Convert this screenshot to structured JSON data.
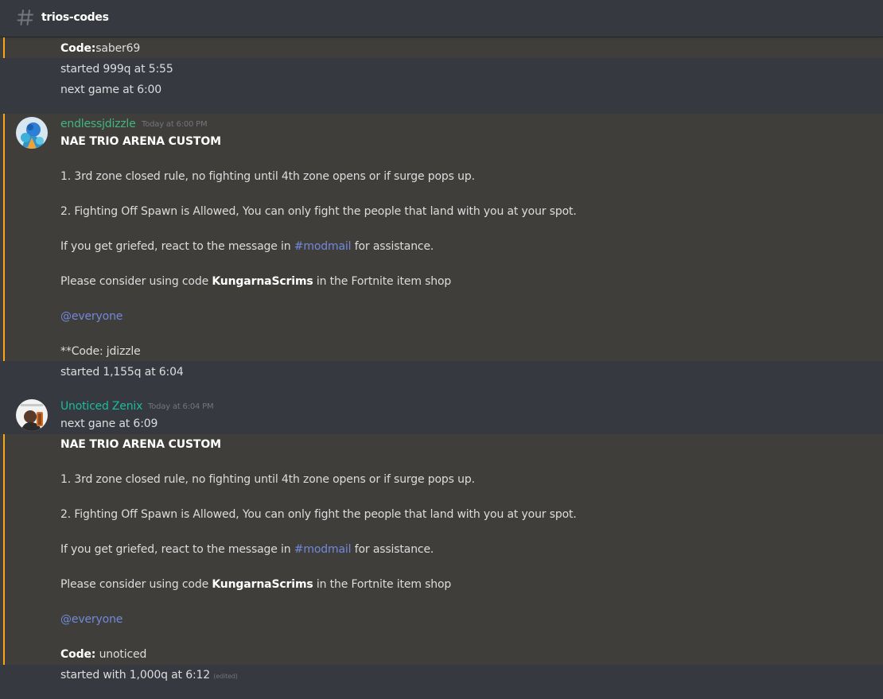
{
  "channel": {
    "name": "trios-codes",
    "icon": "hash-icon"
  },
  "colors": {
    "background": "#36393f",
    "highlight_bg": "#3f3e3b",
    "highlight_bar": "#faa61a",
    "mention": "#7289da",
    "author_jdizzle": "#43b581",
    "author_zenix": "#1abc9c"
  },
  "messages": {
    "m0": {
      "code_label": "Code:",
      "code_value": "saber69",
      "started": "started 999q at 5:55",
      "next": "next game at 6:00"
    },
    "m1": {
      "author": "endlessjdizzle",
      "timestamp": "Today at 6:00 PM",
      "title": "NAE TRIO ARENA CUSTOM",
      "rule1": "1. 3rd zone closed rule, no fighting until 4th zone opens or if surge pops up.",
      "rule2": "2. Fighting Off Spawn is Allowed, You can only fight the people that land with you at your spot.",
      "griefed_pre": "If you get griefed, react to the message in ",
      "griefed_channel": "#modmail",
      "griefed_post": " for assistance.",
      "consider_pre": "Please consider using code ",
      "consider_code": "KungarnaScrims",
      "consider_post": " in the Fortnite item shop",
      "everyone": "@everyone",
      "code_line": "**Code: jdizzle",
      "started": "started 1,155q at 6:04"
    },
    "m2": {
      "author": "Unoticed Zenix",
      "timestamp": "Today at 6:04 PM",
      "next": "next gane at 6:09",
      "title": "NAE TRIO ARENA CUSTOM",
      "rule1": "1. 3rd zone closed rule, no fighting until 4th zone opens or if surge pops up.",
      "rule2": "2. Fighting Off Spawn is Allowed, You can only fight the people that land with you at your spot.",
      "griefed_pre": "If you get griefed, react to the message in ",
      "griefed_channel": "#modmail",
      "griefed_post": " for assistance.",
      "consider_pre": "Please consider using code ",
      "consider_code": "KungarnaScrims",
      "consider_post": " in the Fortnite item shop",
      "everyone": "@everyone",
      "code_label": "Code:",
      "code_value": " unoticed",
      "started": "started with 1,000q at 6:12",
      "edited": "(edited)"
    }
  }
}
